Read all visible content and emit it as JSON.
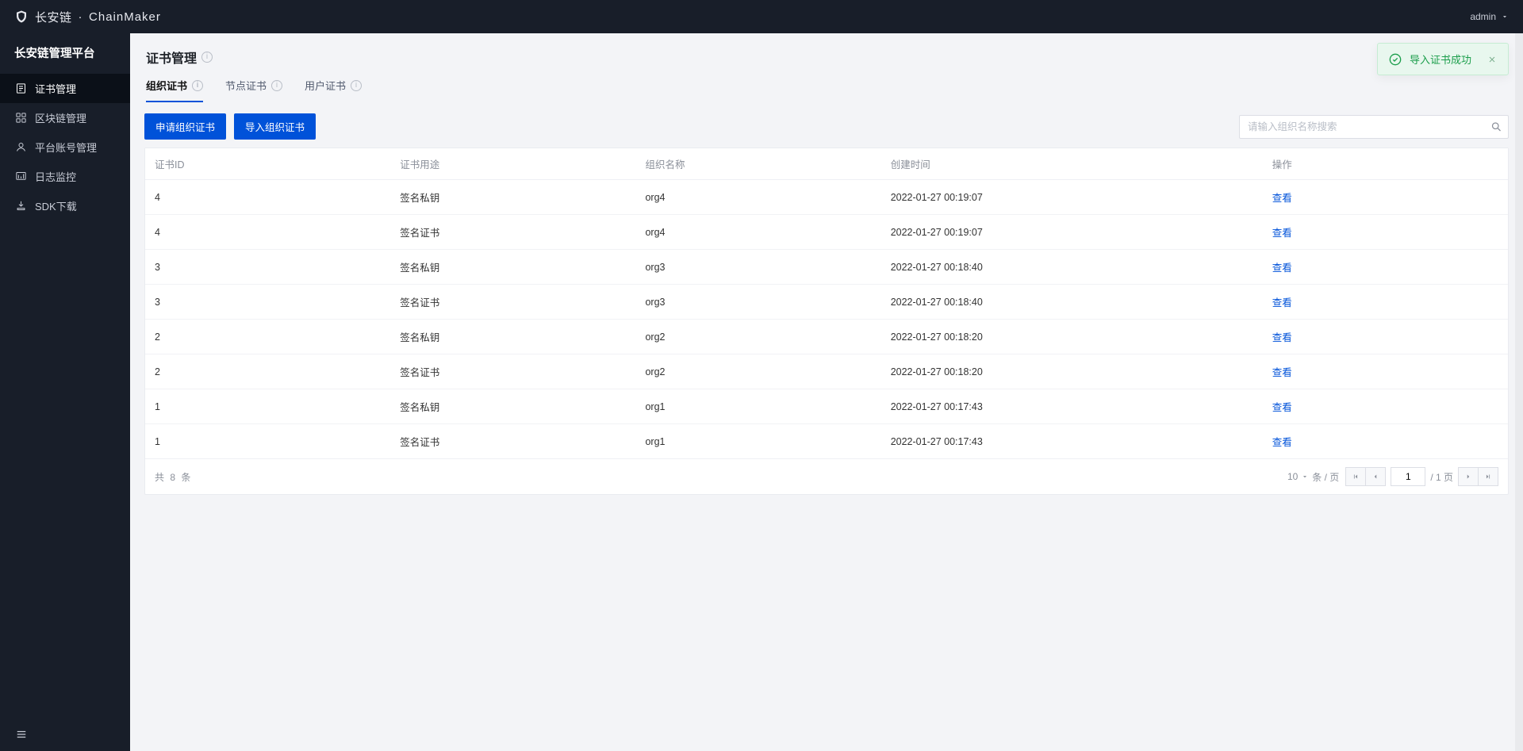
{
  "header": {
    "brand_cn": "长安链",
    "brand_sep": "·",
    "brand_en": "ChainMaker",
    "user_label": "admin"
  },
  "sidebar": {
    "platform_title": "长安链管理平台",
    "items": [
      {
        "label": "证书管理",
        "icon": "cert-icon",
        "active": true
      },
      {
        "label": "区块链管理",
        "icon": "chain-icon",
        "active": false
      },
      {
        "label": "平台账号管理",
        "icon": "account-icon",
        "active": false
      },
      {
        "label": "日志监控",
        "icon": "log-icon",
        "active": false
      },
      {
        "label": "SDK下载",
        "icon": "download-icon",
        "active": false
      }
    ]
  },
  "page": {
    "title": "证书管理"
  },
  "tabs": [
    {
      "label": "组织证书",
      "active": true
    },
    {
      "label": "节点证书",
      "active": false
    },
    {
      "label": "用户证书",
      "active": false
    }
  ],
  "toolbar": {
    "apply_btn": "申请组织证书",
    "import_btn": "导入组织证书",
    "search_placeholder": "请输入组织名称搜索"
  },
  "table": {
    "columns": [
      "证书ID",
      "证书用途",
      "组织名称",
      "创建时间",
      "操作"
    ],
    "op_view": "查看",
    "rows": [
      {
        "id": "4",
        "use": "签名私钥",
        "org": "org4",
        "time": "2022-01-27 00:19:07"
      },
      {
        "id": "4",
        "use": "签名证书",
        "org": "org4",
        "time": "2022-01-27 00:19:07"
      },
      {
        "id": "3",
        "use": "签名私钥",
        "org": "org3",
        "time": "2022-01-27 00:18:40"
      },
      {
        "id": "3",
        "use": "签名证书",
        "org": "org3",
        "time": "2022-01-27 00:18:40"
      },
      {
        "id": "2",
        "use": "签名私钥",
        "org": "org2",
        "time": "2022-01-27 00:18:20"
      },
      {
        "id": "2",
        "use": "签名证书",
        "org": "org2",
        "time": "2022-01-27 00:18:20"
      },
      {
        "id": "1",
        "use": "签名私钥",
        "org": "org1",
        "time": "2022-01-27 00:17:43"
      },
      {
        "id": "1",
        "use": "签名证书",
        "org": "org1",
        "time": "2022-01-27 00:17:43"
      }
    ]
  },
  "pagination": {
    "total_prefix": "共",
    "total_count": "8",
    "total_suffix": "条",
    "page_size": "10",
    "per_page_suffix": "条 / 页",
    "current_page": "1",
    "total_pages_label": "/ 1 页"
  },
  "toast": {
    "message": "导入证书成功"
  }
}
